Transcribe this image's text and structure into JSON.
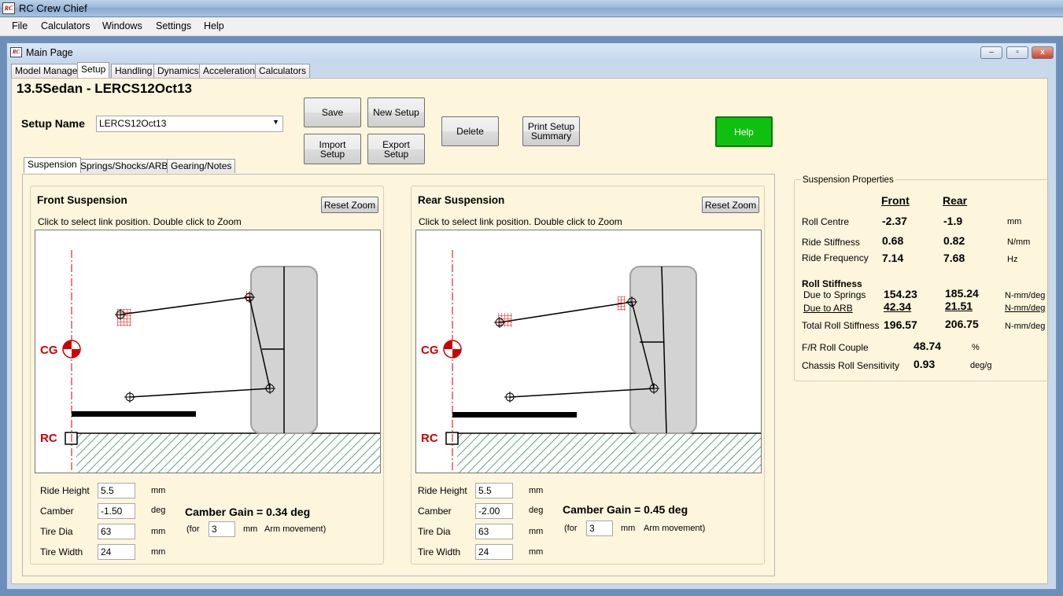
{
  "window": {
    "title": "RC Crew Chief",
    "logo": "RC"
  },
  "menu": {
    "items": [
      {
        "label": "File"
      },
      {
        "label": "Calculators"
      },
      {
        "label": "Windows"
      },
      {
        "label": "Settings"
      },
      {
        "label": "Help"
      }
    ]
  },
  "child_window": {
    "title": "Main Page",
    "min": "–",
    "max": "▫",
    "close": "x"
  },
  "main_tabs": [
    "Model Manager",
    "Setup",
    "Handling",
    "Dynamics",
    "Acceleration",
    "Calculators"
  ],
  "setup": {
    "heading": "13.5Sedan - LERCS12Oct13",
    "name_label": "Setup Name",
    "name_value": "LERCS12Oct13",
    "buttons": {
      "save": "Save",
      "new_setup": "New Setup",
      "import_1": "Import",
      "import_2": "Setup",
      "export_1": "Export",
      "export_2": "Setup",
      "delete": "Delete",
      "print_1": "Print Setup",
      "print_2": "Summary",
      "help": "Help"
    }
  },
  "sub_tabs": [
    "Suspension",
    "Springs/Shocks/ARB",
    "Gearing/Notes"
  ],
  "front": {
    "title": "Front Suspension",
    "hint": "Click to select link position. Double click to Zoom",
    "reset_zoom": "Reset Zoom",
    "cg": "CG",
    "rc": "RC",
    "ride_height_label": "Ride Height",
    "ride_height": "5.5",
    "ride_height_unit": "mm",
    "camber_label": "Camber",
    "camber": "-1.50",
    "camber_unit": "deg",
    "tire_dia_label": "Tire Dia",
    "tire_dia": "63",
    "tire_dia_unit": "mm",
    "tire_width_label": "Tire Width",
    "tire_width": "24",
    "tire_width_unit": "mm",
    "camber_gain": "Camber Gain = 0.34 deg",
    "for_label": "(for",
    "arm_movement": "3",
    "arm_unit": "mm",
    "arm_suffix": "Arm movement)"
  },
  "rear": {
    "title": "Rear Suspension",
    "hint": "Click to select link position. Double click to Zoom",
    "reset_zoom": "Reset Zoom",
    "cg": "CG",
    "rc": "RC",
    "ride_height_label": "Ride Height",
    "ride_height": "5.5",
    "ride_height_unit": "mm",
    "camber_label": "Camber",
    "camber": "-2.00",
    "camber_unit": "deg",
    "tire_dia_label": "Tire Dia",
    "tire_dia": "63",
    "tire_dia_unit": "mm",
    "tire_width_label": "Tire Width",
    "tire_width": "24",
    "tire_width_unit": "mm",
    "camber_gain": "Camber Gain = 0.45 deg",
    "for_label": "(for",
    "arm_movement": "3",
    "arm_unit": "mm",
    "arm_suffix": "Arm movement)"
  },
  "properties": {
    "title": "Suspension Properties",
    "front_head": "Front",
    "rear_head": "Rear",
    "roll_centre": {
      "label": "Roll Centre",
      "front": "-2.37",
      "rear": "-1.9",
      "unit": "mm"
    },
    "ride_stiffness": {
      "label": "Ride Stiffness",
      "front": "0.68",
      "rear": "0.82",
      "unit": "N/mm"
    },
    "ride_frequency": {
      "label": "Ride Frequency",
      "front": "7.14",
      "rear": "7.68",
      "unit": "Hz"
    },
    "roll_stiffness_head": "Roll Stiffness",
    "due_springs": {
      "label": "Due to Springs",
      "front": "154.23",
      "rear": "185.24",
      "unit": "N-mm/deg"
    },
    "due_arb": {
      "label": "Due to ARB",
      "front": "42.34",
      "rear": "21.51",
      "unit": "N-mm/deg"
    },
    "total_roll": {
      "label": "Total Roll Stiffness",
      "front": "196.57",
      "rear": "206.75",
      "unit": "N-mm/deg"
    },
    "roll_couple": {
      "label": "F/R Roll Couple",
      "value": "48.74",
      "unit": "%"
    },
    "roll_sensitivity": {
      "label": "Chassis Roll Sensitivity",
      "value": "0.93",
      "unit": "deg/g"
    }
  },
  "colors": {
    "help_green": "#10c010",
    "panel_bg": "#fdf5dc",
    "cg_red": "#cc0000",
    "ground_hatch": "#1e8a50"
  }
}
